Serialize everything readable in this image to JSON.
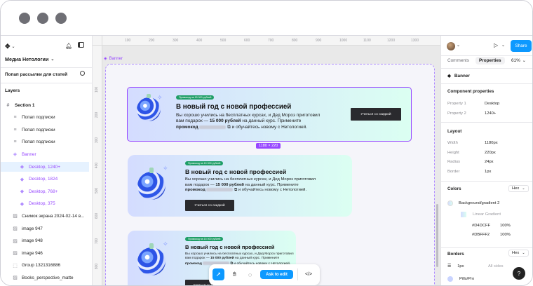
{
  "left_panel": {
    "file_name": "Медиа Нетологии",
    "page_name": "Попап рассылки для статей",
    "layers_title": "Layers",
    "layers": [
      {
        "label": "Section 1",
        "indent": 0,
        "kind": "section",
        "selected": false
      },
      {
        "label": "Попап подписки",
        "indent": 1,
        "kind": "layer",
        "selected": false
      },
      {
        "label": "Попап подписки",
        "indent": 1,
        "kind": "layer",
        "selected": false
      },
      {
        "label": "Попап подписки",
        "indent": 1,
        "kind": "layer",
        "selected": false
      },
      {
        "label": "Banner",
        "indent": 1,
        "kind": "component",
        "selected": false
      },
      {
        "label": "Desktop, 1240+",
        "indent": 2,
        "kind": "variant",
        "selected": true
      },
      {
        "label": "Desktop, 1824",
        "indent": 2,
        "kind": "variant",
        "selected": false
      },
      {
        "label": "Desktop, 768+",
        "indent": 2,
        "kind": "variant",
        "selected": false
      },
      {
        "label": "Desktop, 375",
        "indent": 2,
        "kind": "variant",
        "selected": false
      },
      {
        "label": "Снимок экрана 2024-02-14 в...",
        "indent": 1,
        "kind": "image",
        "selected": false
      },
      {
        "label": "image 947",
        "indent": 1,
        "kind": "image",
        "selected": false
      },
      {
        "label": "image 948",
        "indent": 1,
        "kind": "image",
        "selected": false
      },
      {
        "label": "image 946",
        "indent": 1,
        "kind": "image",
        "selected": false
      },
      {
        "label": "Group 1321316886",
        "indent": 1,
        "kind": "group",
        "selected": false
      },
      {
        "label": "Books_perspective_matte",
        "indent": 1,
        "kind": "image",
        "selected": false
      }
    ]
  },
  "canvas": {
    "frame_label": "Banner",
    "ruler_top": [
      "100",
      "200",
      "300",
      "400",
      "500",
      "600",
      "700",
      "800",
      "900",
      "1000",
      "1100",
      "1200",
      "1300"
    ],
    "ruler_left": [
      "100",
      "200",
      "300",
      "400",
      "500",
      "600",
      "700",
      "800",
      "900"
    ],
    "size_badge": "1180 × 220",
    "banner": {
      "promo": "Промокод на 15 000 рублей",
      "title": "В новый год с новой профессией",
      "text_1": "Вы хорошо учились на бесплатных курсах, и Дед Мороз приготовил",
      "text_2_pre": "вам подарок — ",
      "text_2_bold": "15 000 рублей",
      "text_2_post": " на данный курс. Примените",
      "text_3_bold": "промокод",
      "text_3_post": " и обучайтесь новому с Нетологией.",
      "button": "Учиться со скидкой"
    },
    "toolbar": {
      "ask_label": "Ask to edit"
    }
  },
  "right_panel": {
    "tabs": [
      "Comments",
      "Properties"
    ],
    "zoom": "61%",
    "share_label": "Share",
    "selection_name": "Banner",
    "component_properties_title": "Component properties",
    "properties": [
      {
        "label": "Property 1",
        "value": "Desktop"
      },
      {
        "label": "Property 2",
        "value": "1240+"
      }
    ],
    "layout_title": "Layout",
    "layout": [
      {
        "label": "Width",
        "value": "1180px"
      },
      {
        "label": "Height",
        "value": "220px"
      },
      {
        "label": "Radius",
        "value": "24px"
      },
      {
        "label": "Border",
        "value": "1px"
      }
    ],
    "colors_title": "Colors",
    "colors_format": "Hex",
    "fill_name": "Background/gradient 2",
    "gradient_name": "Linear Gradient",
    "stops": [
      {
        "hex": "#D4DCFF",
        "opacity": "100%"
      },
      {
        "hex": "#DBFFF2",
        "opacity": "100%"
      }
    ],
    "borders_title": "Borders",
    "borders_format": "Hex",
    "border_width": "1px",
    "border_sides": "All sides",
    "border_fill": "Pills/Pro",
    "help_label": "?"
  },
  "colors": {
    "accent": "#0d99ff",
    "selection": "#9747ff",
    "gradient_start": "#D4DCFF",
    "gradient_end": "#DBFFF2",
    "promo_green": "#1f9e67"
  }
}
